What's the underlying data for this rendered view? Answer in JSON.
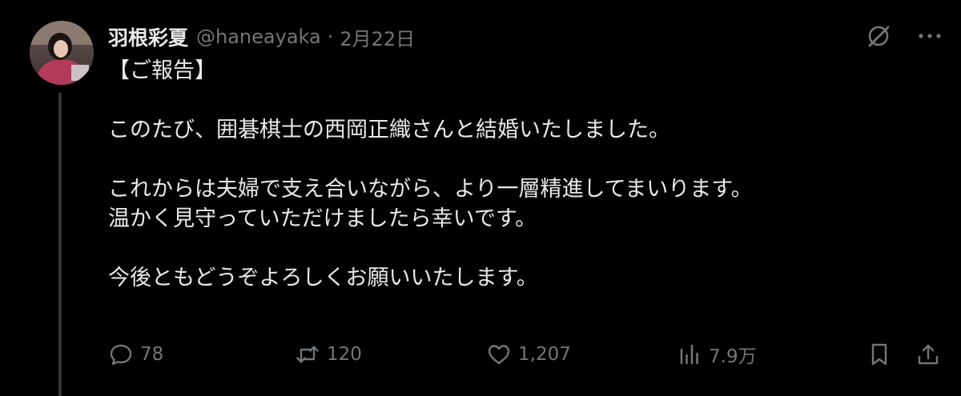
{
  "author": {
    "display_name": "羽根彩夏",
    "handle": "@haneayaka",
    "separator": "·",
    "date": "2月22日"
  },
  "tweet": {
    "lines": [
      "【ご報告】",
      "",
      "このたび、囲碁棋士の西岡正織さんと結婚いたしました。",
      "",
      "これからは夫婦で支え合いながら、より一層精進してまいります。",
      "温かく見守っていただけましたら幸いです。",
      "",
      "今後ともどうぞよろしくお願いいたします。"
    ]
  },
  "actions": {
    "replies": "78",
    "reposts": "120",
    "likes": "1,207",
    "views": "7.9万"
  },
  "icons": {
    "top": [
      "grok-icon",
      "more-icon"
    ],
    "bottom": [
      "reply-icon",
      "repost-icon",
      "like-icon",
      "views-icon",
      "bookmark-icon",
      "share-icon"
    ]
  },
  "colors": {
    "background": "#000000",
    "text": "#e7e9ea",
    "secondary": "#71767b",
    "thread_line": "#333639"
  }
}
